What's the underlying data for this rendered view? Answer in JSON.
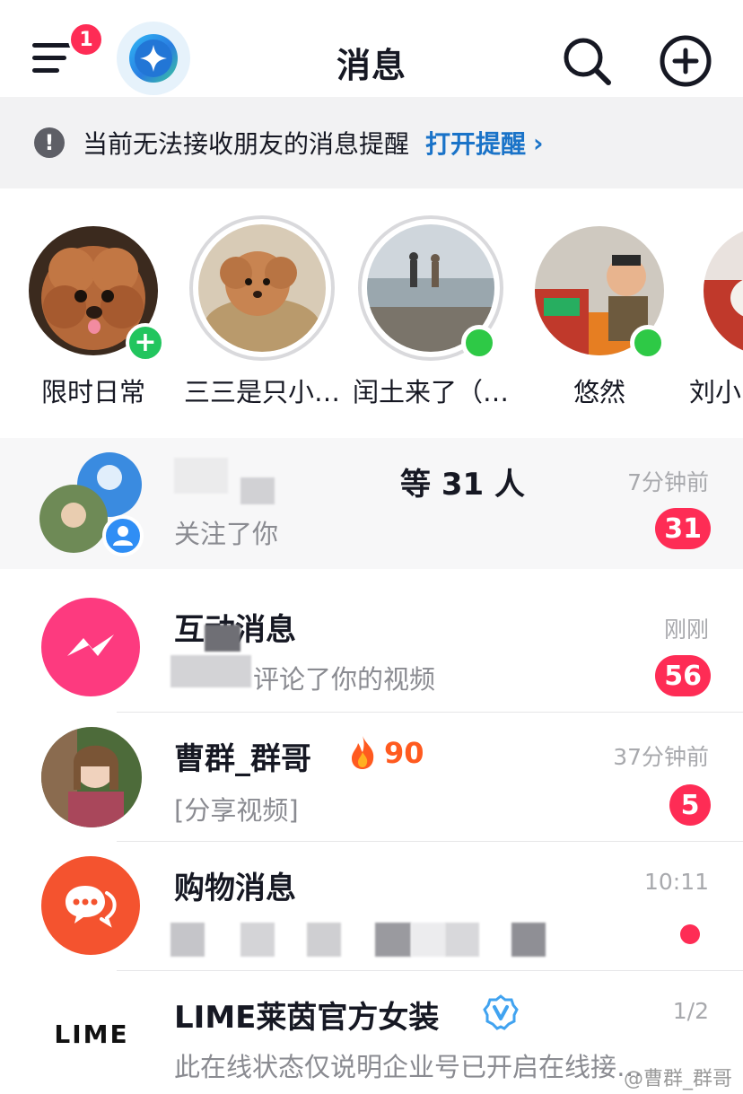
{
  "header": {
    "title": "消息",
    "menu_badge": "1",
    "icons": {
      "menu": "hamburger-icon",
      "ai": "sparkle-icon",
      "search": "search-icon",
      "add": "plus-circle-icon"
    }
  },
  "notice": {
    "icon": "info-icon",
    "icon_glyph": "!",
    "text": "当前无法接收朋友的消息提醒",
    "action": "打开提醒",
    "chevron": "›"
  },
  "stories": [
    {
      "name": "限时日常",
      "badge": "add"
    },
    {
      "name": "三三是只小…",
      "badge": "ring"
    },
    {
      "name": "闰土来了（…",
      "badge": "online"
    },
    {
      "name": "悠然",
      "badge": "online"
    },
    {
      "name": "刘小",
      "badge": "none"
    }
  ],
  "story_plus": "+",
  "chats": [
    {
      "title": "等 31 人",
      "subtitle": "关注了你",
      "time": "7分钟前",
      "count": "31"
    },
    {
      "title": "互动消息",
      "subtitle": "评论了你的视频",
      "time": "刚刚",
      "count": "56"
    },
    {
      "title": "曹群_群哥",
      "flame_score": "90",
      "subtitle": "[分享视频]",
      "time": "37分钟前",
      "count": "5"
    },
    {
      "title": "购物消息",
      "subtitle": "",
      "time": "10:11",
      "count": ""
    },
    {
      "title": "LIME莱茵官方女装",
      "logo_text": "LIME",
      "subtitle": "此在线状态仅说明企业号已开启在线接…",
      "time": "1/2",
      "count": ""
    }
  ],
  "watermark": "@曹群_群哥",
  "colors": {
    "accent_red": "#fe2c55",
    "link_blue": "#1a73c8",
    "online_green": "#2ec946",
    "interaction_pink": "#fd3a7f",
    "shop_orange": "#f4532f"
  }
}
